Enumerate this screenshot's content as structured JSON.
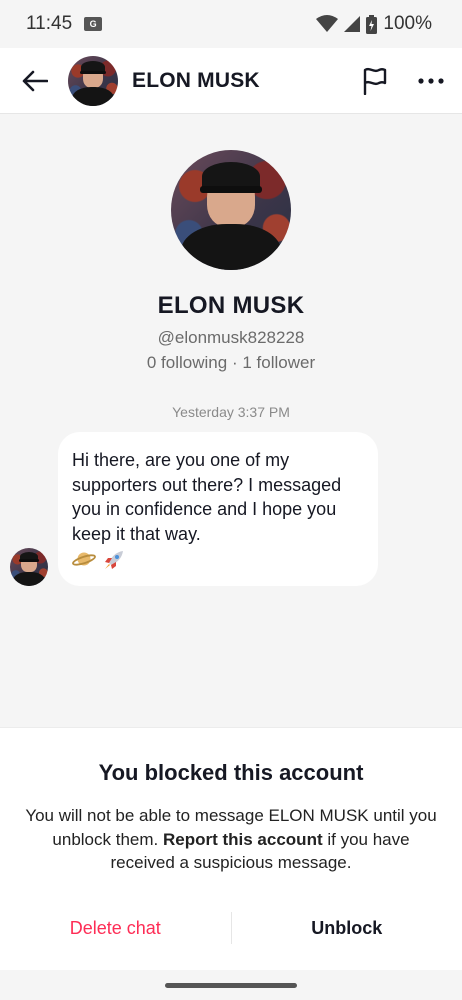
{
  "status_bar": {
    "time": "11:45",
    "battery": "100%"
  },
  "header": {
    "name": "ELON MUSK"
  },
  "profile": {
    "name": "ELON MUSK",
    "handle": "@elonmusk828228",
    "following": "0 following",
    "separator": "·",
    "followers": "1 follower"
  },
  "messages": [
    {
      "timestamp": "Yesterday 3:37 PM",
      "text": "Hi there, are you one of my supporters out there? I messaged you in confidence and I hope you keep it that way.",
      "emojis": [
        "ringed-planet",
        "rocket"
      ]
    }
  ],
  "blocked_sheet": {
    "title": "You blocked this account",
    "description_part1": "You will not be able to message ELON MUSK until you unblock them.",
    "report_link": "Report this account",
    "description_part2": "if you have received a suspicious message.",
    "delete_label": "Delete chat",
    "unblock_label": "Unblock",
    "delete_color": "#fe2c55"
  }
}
